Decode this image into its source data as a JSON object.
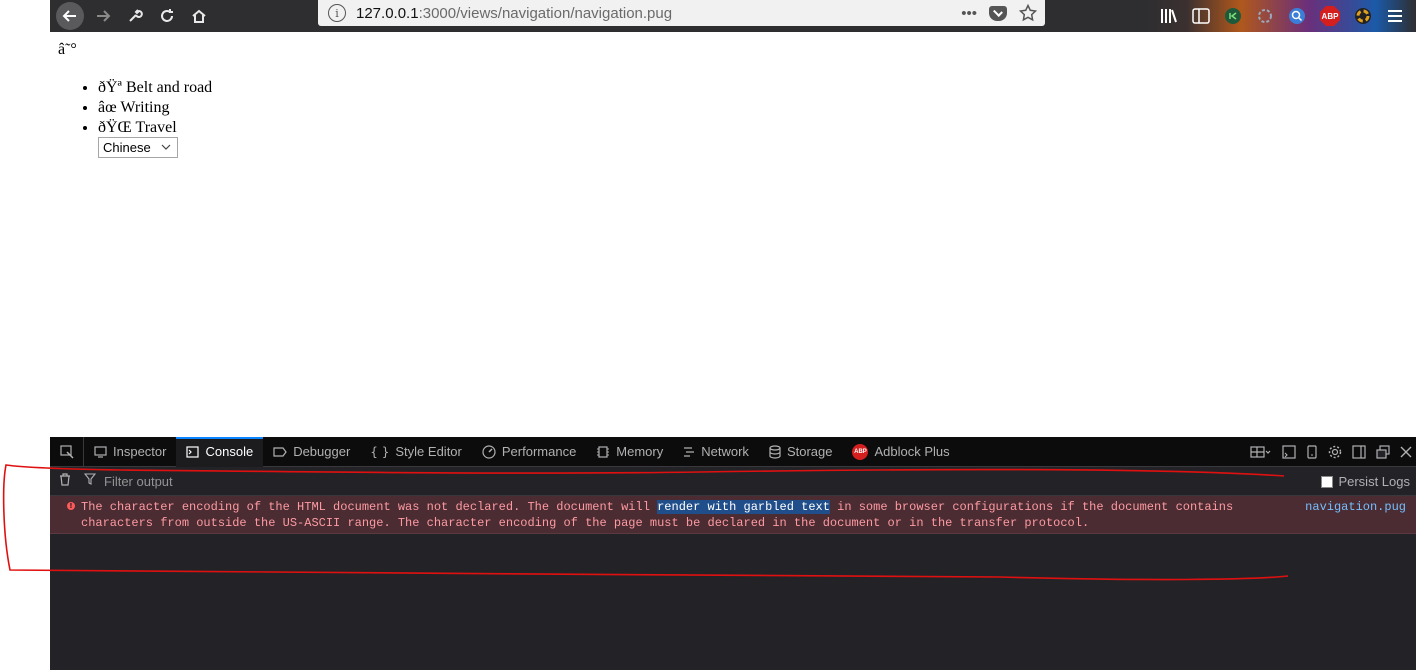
{
  "browser": {
    "url_host": "127.0.0.1",
    "url_path": ":3000/views/navigation/navigation.pug",
    "more_label": "•••",
    "info_label": "i"
  },
  "page": {
    "heading": "â˜°",
    "nav_items": [
      {
        "label": "ðŸª Belt and road"
      },
      {
        "label": "âœ Writing"
      },
      {
        "label": "ðŸŒ Travel"
      }
    ],
    "language_select": {
      "value": "Chinese"
    }
  },
  "devtools": {
    "tabs": [
      {
        "label": "Inspector",
        "icon": "inspector-icon"
      },
      {
        "label": "Console",
        "icon": "console-icon",
        "active": true
      },
      {
        "label": "Debugger",
        "icon": "debugger-icon"
      },
      {
        "label": "Style Editor",
        "icon": "style-editor-icon"
      },
      {
        "label": "Performance",
        "icon": "performance-icon"
      },
      {
        "label": "Memory",
        "icon": "memory-icon"
      },
      {
        "label": "Network",
        "icon": "network-icon"
      },
      {
        "label": "Storage",
        "icon": "storage-icon"
      },
      {
        "label": "Adblock Plus",
        "icon": "adblock-plus-icon"
      }
    ],
    "filter_placeholder": "Filter output",
    "persist_logs_label": "Persist Logs",
    "abp_label": "ABP",
    "message": {
      "text_before": "The character encoding of the HTML document was not declared. The document will ",
      "highlighted": "render with garbled text",
      "text_after": " in some browser configurations if the document contains characters from outside the US-ASCII range. The character encoding of the page must be declared in the document or in the transfer protocol.",
      "source": "navigation.pug"
    }
  },
  "colors": {
    "annotation_stroke": "#e01010",
    "error_text": "#ff9aa2",
    "highlight_bg": "#204e8a",
    "source_link": "#75bfff"
  }
}
